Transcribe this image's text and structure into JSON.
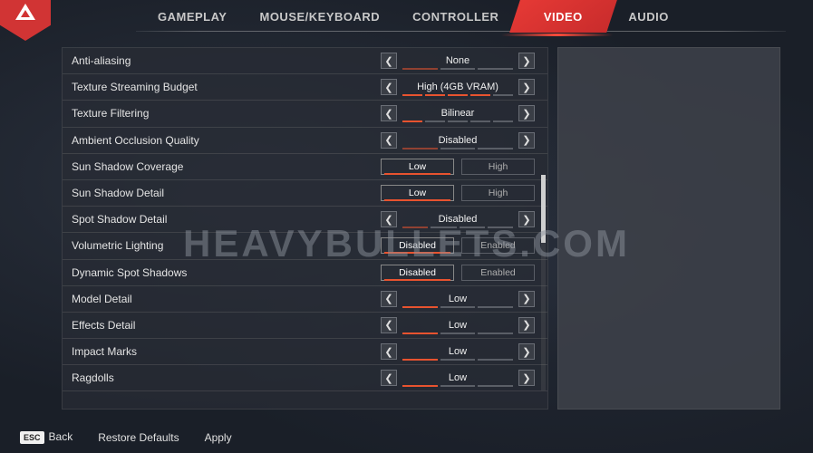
{
  "watermark": "HEAVYBULLETS.COM",
  "tabs": {
    "gameplay": "GAMEPLAY",
    "mousekb": "MOUSE/KEYBOARD",
    "controller": "CONTROLLER",
    "video": "VIDEO",
    "audio": "AUDIO"
  },
  "settings": [
    {
      "label": "Anti-aliasing",
      "type": "select",
      "value": "None",
      "segments": 3,
      "on": 0
    },
    {
      "label": "Texture Streaming Budget",
      "type": "select",
      "value": "High (4GB VRAM)",
      "segments": 5,
      "on": 4
    },
    {
      "label": "Texture Filtering",
      "type": "select",
      "value": "Bilinear",
      "segments": 5,
      "on": 1
    },
    {
      "label": "Ambient Occlusion Quality",
      "type": "select",
      "value": "Disabled",
      "segments": 3,
      "on": 0
    },
    {
      "label": "Sun Shadow Coverage",
      "type": "toggle",
      "options": [
        "Low",
        "High"
      ],
      "selected": 0
    },
    {
      "label": "Sun Shadow Detail",
      "type": "toggle",
      "options": [
        "Low",
        "High"
      ],
      "selected": 0
    },
    {
      "label": "Spot Shadow Detail",
      "type": "select",
      "value": "Disabled",
      "segments": 4,
      "on": 0
    },
    {
      "label": "Volumetric Lighting",
      "type": "toggle",
      "options": [
        "Disabled",
        "Enabled"
      ],
      "selected": 0
    },
    {
      "label": "Dynamic Spot Shadows",
      "type": "toggle",
      "options": [
        "Disabled",
        "Enabled"
      ],
      "selected": 0
    },
    {
      "label": "Model Detail",
      "type": "select",
      "value": "Low",
      "segments": 3,
      "on": 1
    },
    {
      "label": "Effects Detail",
      "type": "select",
      "value": "Low",
      "segments": 3,
      "on": 1
    },
    {
      "label": "Impact Marks",
      "type": "select",
      "value": "Low",
      "segments": 3,
      "on": 1
    },
    {
      "label": "Ragdolls",
      "type": "select",
      "value": "Low",
      "segments": 3,
      "on": 1
    }
  ],
  "footer": {
    "back_key": "ESC",
    "back": "Back",
    "restore": "Restore Defaults",
    "apply": "Apply"
  }
}
